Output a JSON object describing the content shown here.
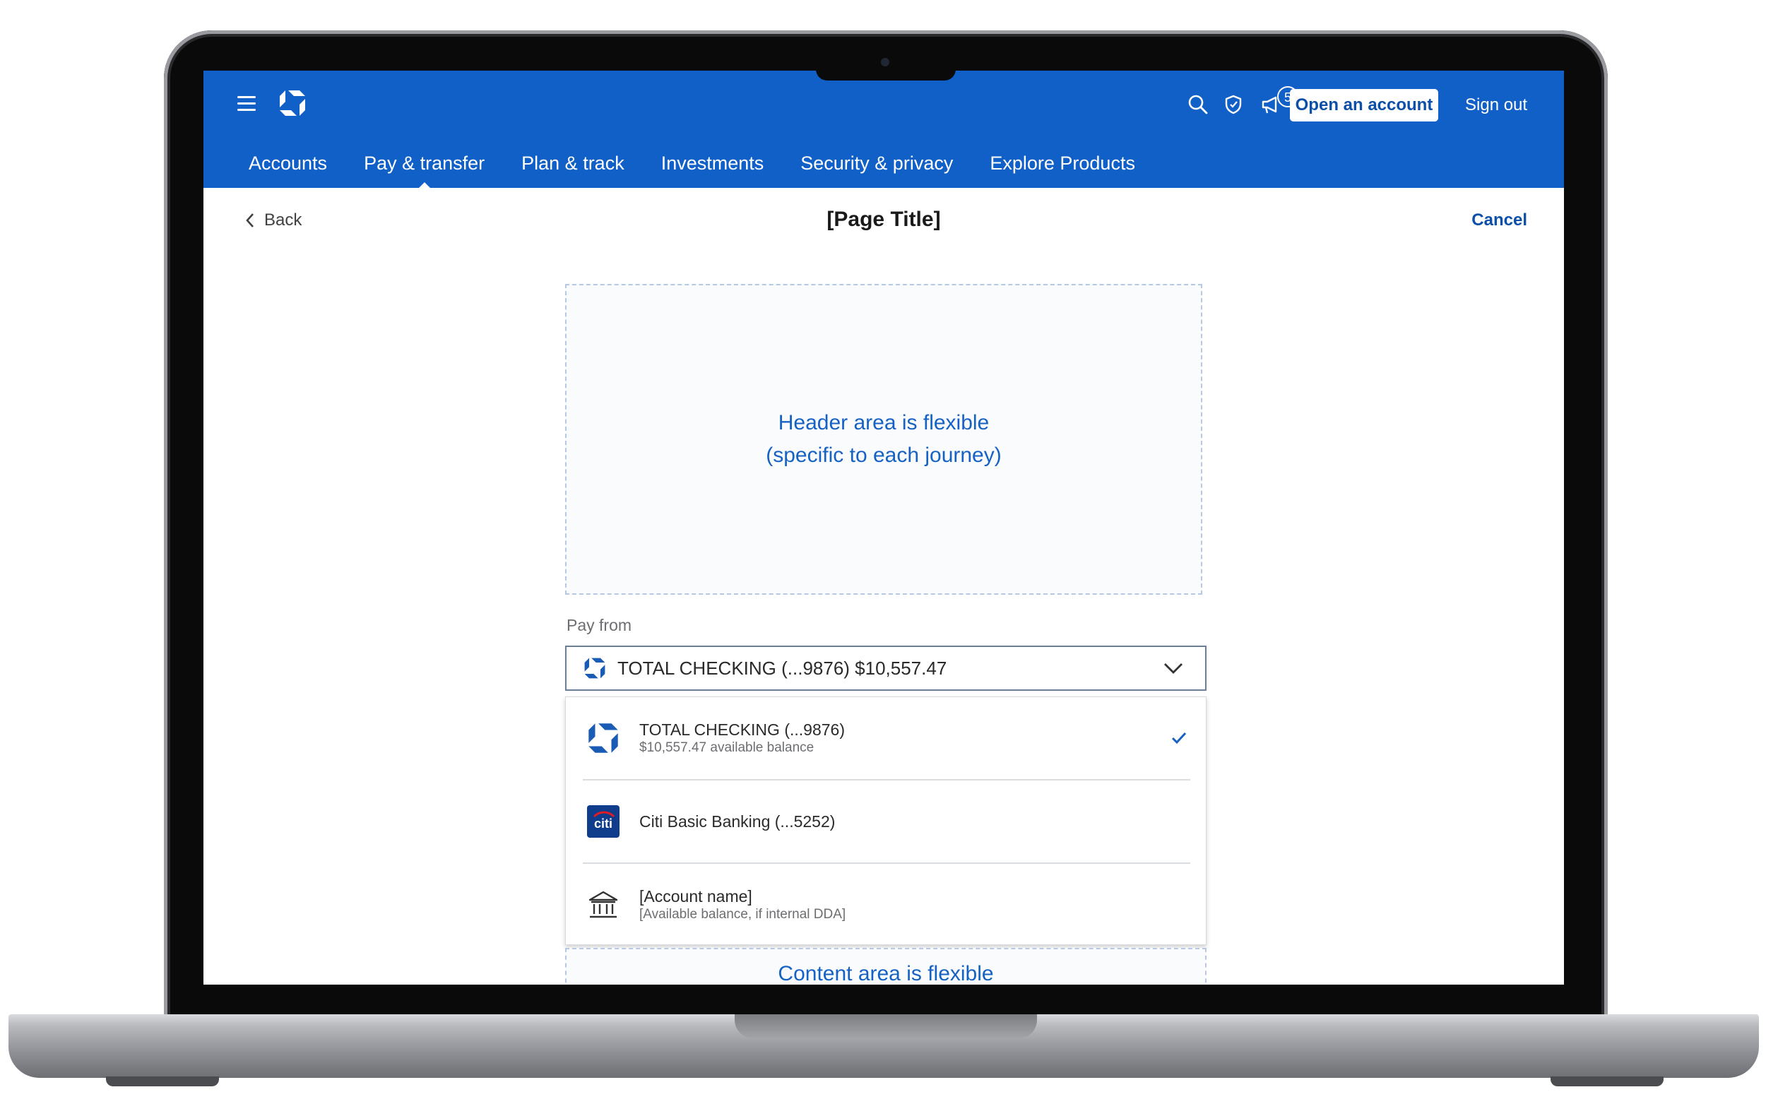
{
  "colors": {
    "brand_blue": "#1060c8",
    "link_blue": "#0b4fa8",
    "placeholder_blue": "#1662c4"
  },
  "header": {
    "icons": [
      "menu-icon",
      "chase-logo",
      "search-icon",
      "shield-icon",
      "megaphone-icon",
      "profile-icon"
    ],
    "notification_count": "5",
    "open_account_label": "Open an account",
    "sign_out_label": "Sign out"
  },
  "nav": {
    "tabs": [
      {
        "label": "Accounts"
      },
      {
        "label": "Pay & transfer",
        "active": true
      },
      {
        "label": "Plan & track"
      },
      {
        "label": "Investments"
      },
      {
        "label": "Security & privacy"
      },
      {
        "label": "Explore Products"
      }
    ]
  },
  "subheader": {
    "back_label": "Back",
    "title": "[Page Title]",
    "cancel_label": "Cancel"
  },
  "header_area": {
    "line1": "Header area is flexible",
    "line2": "(specific to each journey)"
  },
  "pay_from": {
    "label": "Pay from",
    "selected": "TOTAL CHECKING (...9876) $10,557.47",
    "options": [
      {
        "name": "TOTAL CHECKING (...9876)",
        "sub": "$10,557.47 available balance",
        "icon": "chase-logo",
        "selected": true
      },
      {
        "name": "Citi Basic Banking (...5252)",
        "sub": "",
        "icon": "citi-logo",
        "logo_text": "citi",
        "selected": false
      },
      {
        "name": "[Account name]",
        "sub": "[Available balance, if internal DDA]",
        "icon": "bank-icon",
        "selected": false
      }
    ]
  },
  "content_area": {
    "label": "Content area is flexible"
  }
}
